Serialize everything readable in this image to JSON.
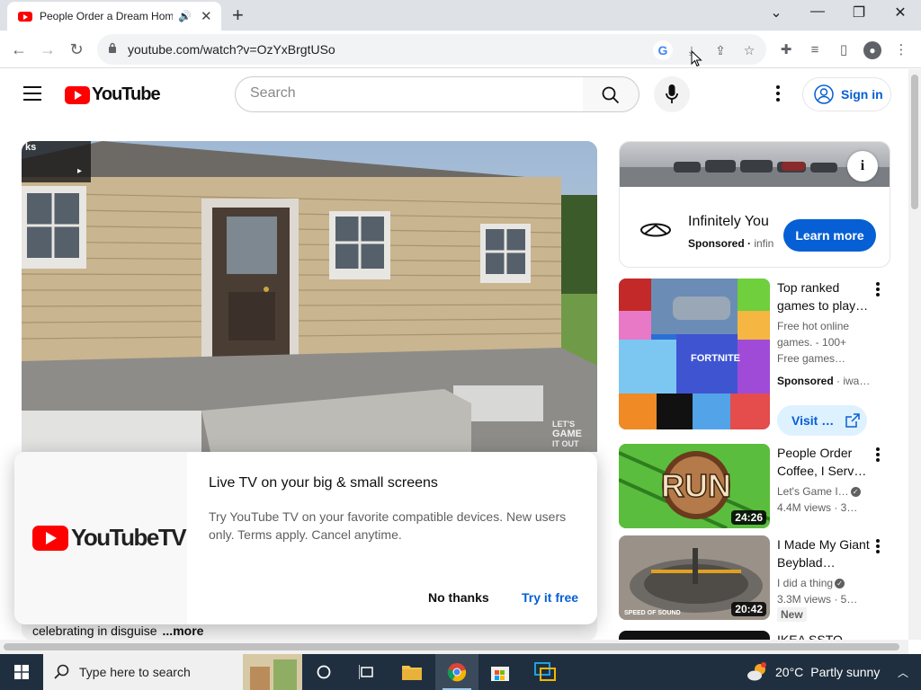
{
  "browser": {
    "tab_title": "People Order a Dream Home",
    "url": "youtube.com/watch?v=OzYxBrgtUSo"
  },
  "youtube": {
    "logo_text": "YouTube",
    "search_placeholder": "Search",
    "sign_in": "Sign in"
  },
  "video": {
    "overlay_fragment": "ks",
    "watermark_line1": "LET'S",
    "watermark_line2": "GAME",
    "watermark_line3": "IT OUT",
    "description": "celebrating in disguise",
    "more": "...more"
  },
  "promo": {
    "logo_text": "YouTubeTV",
    "heading": "Live TV on your big & small screens",
    "body": "Try YouTube TV on your favorite compatible devices. New users only. Terms apply. Cancel anytime.",
    "dismiss": "No thanks",
    "accept": "Try it free"
  },
  "ad": {
    "name": "Infinitely You",
    "sponsored": "Sponsored",
    "advertiser": "infin",
    "cta": "Learn more"
  },
  "recommendations": [
    {
      "title": "Top ranked games to play…",
      "meta1": "Free hot online games. - 100+ Free games…",
      "sponsored": "Sponsored",
      "advertiser": "iwa…",
      "cta": "Visit …"
    },
    {
      "title": "People Order Coffee, I Serv…",
      "channel": "Let's Game I…",
      "stats": "4.4M views · 3…",
      "duration": "24:26",
      "thumb_text": "RUN"
    },
    {
      "title": "I Made My Giant Beyblad…",
      "channel": "I did a thing",
      "stats": "3.3M views · 5…",
      "duration": "20:42",
      "badge": "New",
      "thumb_caption": "SPEED OF SOUND"
    },
    {
      "title": "IKEA SSTO"
    }
  ],
  "taskbar": {
    "search_placeholder": "Type here to search",
    "temperature": "20°C",
    "condition": "Partly sunny"
  }
}
